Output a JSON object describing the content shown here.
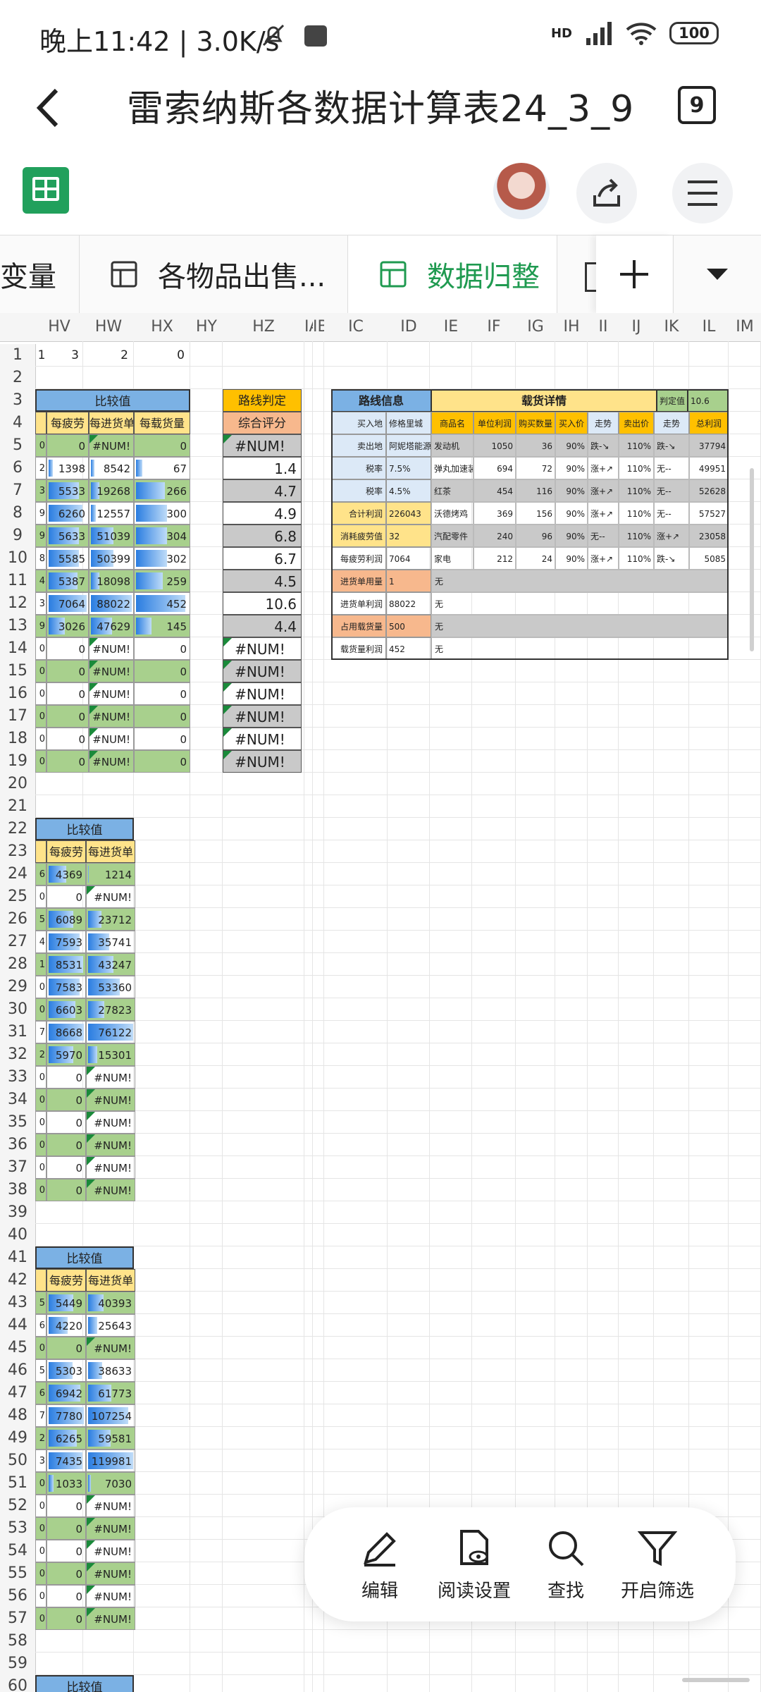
{
  "status": {
    "time": "晚上11:42 | 3.0K/s",
    "net": "HD",
    "battery": "100"
  },
  "header": {
    "title": "雷索纳斯各数据计算表24_3_9",
    "tab_count": "9"
  },
  "sheet_tabs": [
    {
      "label": "变量"
    },
    {
      "label": "各物品出售..."
    },
    {
      "label": "数据归整"
    }
  ],
  "columns": [
    "HV",
    "HW",
    "HX",
    "HY",
    "HZ",
    "IA",
    "IB",
    "IC",
    "ID",
    "IE",
    "IF",
    "IG",
    "IH",
    "II",
    "IJ",
    "IK",
    "IL",
    "IM"
  ],
  "rows": [
    "1",
    "2",
    "3",
    "4",
    "5",
    "6",
    "7",
    "8",
    "9",
    "10",
    "11",
    "12",
    "13",
    "14",
    "15",
    "16",
    "17",
    "18",
    "19",
    "20",
    "21",
    "22",
    "23",
    "24",
    "25",
    "26",
    "27",
    "28",
    "29",
    "30",
    "31",
    "32",
    "33",
    "34",
    "35",
    "36",
    "37",
    "38",
    "39",
    "40",
    "41",
    "42",
    "43",
    "44",
    "45",
    "46",
    "47",
    "48",
    "49",
    "50",
    "51",
    "52",
    "53",
    "54",
    "55",
    "56",
    "57",
    "58",
    "59",
    "60"
  ],
  "row1": {
    "hv": "3",
    "hw": "2",
    "hx": "0",
    "left": "1"
  },
  "block1": {
    "title": "比较值",
    "headers": [
      "每疲劳",
      "每进货单",
      "每载货量"
    ],
    "rows": [
      {
        "l": "0",
        "a": "0",
        "b": "#NUM!",
        "c": "0",
        "g": 1
      },
      {
        "l": "2",
        "a": "1398",
        "b": "8542",
        "c": "67",
        "g": 0,
        "pa": 0.12,
        "pb": 0.08,
        "pc": 0.12
      },
      {
        "l": "3",
        "a": "5533",
        "b": "19268",
        "c": "266",
        "g": 1,
        "pa": 0.8,
        "pb": 0.2,
        "pc": 0.55
      },
      {
        "l": "9",
        "a": "6260",
        "b": "12557",
        "c": "300",
        "g": 0,
        "pa": 0.88,
        "pb": 0.12,
        "pc": 0.6
      },
      {
        "l": "9",
        "a": "5633",
        "b": "51039",
        "c": "304",
        "g": 1,
        "pa": 0.8,
        "pb": 0.55,
        "pc": 0.6
      },
      {
        "l": "8",
        "a": "5585",
        "b": "50399",
        "c": "302",
        "g": 0,
        "pa": 0.79,
        "pb": 0.55,
        "pc": 0.6
      },
      {
        "l": "4",
        "a": "5387",
        "b": "18098",
        "c": "259",
        "g": 1,
        "pa": 0.76,
        "pb": 0.2,
        "pc": 0.52
      },
      {
        "l": "3",
        "a": "7064",
        "b": "88022",
        "c": "452",
        "g": 0,
        "pa": 1.0,
        "pb": 1.0,
        "pc": 0.95
      },
      {
        "l": "9",
        "a": "3026",
        "b": "47629",
        "c": "145",
        "g": 1,
        "pa": 0.43,
        "pb": 0.52,
        "pc": 0.3
      },
      {
        "l": "0",
        "a": "0",
        "b": "#NUM!",
        "c": "0",
        "g": 0
      },
      {
        "l": "0",
        "a": "0",
        "b": "#NUM!",
        "c": "0",
        "g": 1
      },
      {
        "l": "0",
        "a": "0",
        "b": "#NUM!",
        "c": "0",
        "g": 0
      },
      {
        "l": "0",
        "a": "0",
        "b": "#NUM!",
        "c": "0",
        "g": 1
      },
      {
        "l": "0",
        "a": "0",
        "b": "#NUM!",
        "c": "0",
        "g": 0
      },
      {
        "l": "0",
        "a": "0",
        "b": "#NUM!",
        "c": "0",
        "g": 1
      }
    ]
  },
  "route": {
    "title": "路线判定",
    "subtitle": "综合评分",
    "scores": [
      "#NUM!",
      "1.4",
      "4.7",
      "4.9",
      "6.8",
      "6.7",
      "4.5",
      "10.6",
      "4.4",
      "#NUM!",
      "#NUM!",
      "#NUM!",
      "#NUM!",
      "#NUM!",
      "#NUM!"
    ]
  },
  "info": {
    "title": "路线信息",
    "cargo_title": "载货详情",
    "judge_label": "判定值",
    "judge_value": "10.6",
    "headers": [
      "商品名",
      "单位利润",
      "购买数量",
      "买入价",
      "走势",
      "卖出价",
      "走势",
      "总利润"
    ],
    "left": [
      {
        "k": "买入地",
        "v": "修格里城"
      },
      {
        "k": "卖出地",
        "v": "阿妮塔能源"
      },
      {
        "k": "税率",
        "v": "7.5%"
      },
      {
        "k": "税率",
        "v": "4.5%"
      },
      {
        "k": "合计利润",
        "v": "226043"
      },
      {
        "k": "消耗疲劳值",
        "v": "32"
      },
      {
        "k": "每疲劳利润",
        "v": "7064"
      },
      {
        "k": "进货单用量",
        "v": "1"
      },
      {
        "k": "进货单利润",
        "v": "88022"
      },
      {
        "k": "占用载货量",
        "v": "500"
      },
      {
        "k": "载货量利润",
        "v": "452"
      }
    ],
    "goods": [
      [
        "发动机",
        "1050",
        "36",
        "90%",
        "跌-↘",
        "110%",
        "跌-↘",
        "37794"
      ],
      [
        "弹丸加速装置",
        "694",
        "72",
        "90%",
        "涨+↗",
        "110%",
        "无--",
        "49951"
      ],
      [
        "红茶",
        "454",
        "116",
        "90%",
        "涨+↗",
        "110%",
        "无--",
        "52628"
      ],
      [
        "沃德烤鸡",
        "369",
        "156",
        "90%",
        "涨+↗",
        "110%",
        "无--",
        "57527"
      ],
      [
        "汽配零件",
        "240",
        "96",
        "90%",
        "无--",
        "110%",
        "涨+↗",
        "23058"
      ],
      [
        "家电",
        "212",
        "24",
        "90%",
        "涨+↗",
        "110%",
        "跌-↘",
        "5085"
      ]
    ],
    "none": "无"
  },
  "block2": {
    "title": "比较值",
    "headers": [
      "每疲劳",
      "每进货单"
    ],
    "rows": [
      {
        "l": "6",
        "a": "4369",
        "b": "1214",
        "g": 1,
        "pa": 0.5,
        "pb": 0.01
      },
      {
        "l": "0",
        "a": "0",
        "b": "#NUM!",
        "g": 0
      },
      {
        "l": "5",
        "a": "6089",
        "b": "23712",
        "g": 1,
        "pa": 0.7,
        "pb": 0.3
      },
      {
        "l": "4",
        "a": "7593",
        "b": "35741",
        "g": 0,
        "pa": 0.87,
        "pb": 0.47
      },
      {
        "l": "1",
        "a": "8531",
        "b": "43247",
        "g": 1,
        "pa": 0.98,
        "pb": 0.57
      },
      {
        "l": "0",
        "a": "7583",
        "b": "53360",
        "g": 0,
        "pa": 0.87,
        "pb": 0.7
      },
      {
        "l": "0",
        "a": "6603",
        "b": "27823",
        "g": 1,
        "pa": 0.76,
        "pb": 0.36
      },
      {
        "l": "7",
        "a": "8668",
        "b": "76122",
        "g": 0,
        "pa": 1.0,
        "pb": 1.0
      },
      {
        "l": "2",
        "a": "5970",
        "b": "15301",
        "g": 1,
        "pa": 0.69,
        "pb": 0.2
      },
      {
        "l": "0",
        "a": "0",
        "b": "#NUM!",
        "g": 0
      },
      {
        "l": "0",
        "a": "0",
        "b": "#NUM!",
        "g": 1
      },
      {
        "l": "0",
        "a": "0",
        "b": "#NUM!",
        "g": 0
      },
      {
        "l": "0",
        "a": "0",
        "b": "#NUM!",
        "g": 1
      },
      {
        "l": "0",
        "a": "0",
        "b": "#NUM!",
        "g": 0
      },
      {
        "l": "0",
        "a": "0",
        "b": "#NUM!",
        "g": 1
      }
    ]
  },
  "block3": {
    "title": "比较值",
    "headers": [
      "每疲劳",
      "每进货单"
    ],
    "rows": [
      {
        "l": "5",
        "a": "5449",
        "b": "40393",
        "g": 1,
        "pa": 0.7,
        "pb": 0.34
      },
      {
        "l": "6",
        "a": "4220",
        "b": "25643",
        "g": 0,
        "pa": 0.54,
        "pb": 0.21
      },
      {
        "l": "0",
        "a": "0",
        "b": "#NUM!",
        "g": 1
      },
      {
        "l": "5",
        "a": "5303",
        "b": "38633",
        "g": 0,
        "pa": 0.68,
        "pb": 0.32
      },
      {
        "l": "6",
        "a": "6942",
        "b": "61773",
        "g": 1,
        "pa": 0.89,
        "pb": 0.51
      },
      {
        "l": "7",
        "a": "7780",
        "b": "107254",
        "g": 0,
        "pa": 1.0,
        "pb": 0.89
      },
      {
        "l": "2",
        "a": "6265",
        "b": "59581",
        "g": 1,
        "pa": 0.8,
        "pb": 0.5
      },
      {
        "l": "3",
        "a": "7435",
        "b": "119981",
        "g": 0,
        "pa": 0.95,
        "pb": 1.0
      },
      {
        "l": "0",
        "a": "1033",
        "b": "7030",
        "g": 1,
        "pa": 0.13,
        "pb": 0.06
      },
      {
        "l": "0",
        "a": "0",
        "b": "#NUM!",
        "g": 0
      },
      {
        "l": "0",
        "a": "0",
        "b": "#NUM!",
        "g": 1
      },
      {
        "l": "0",
        "a": "0",
        "b": "#NUM!",
        "g": 0
      },
      {
        "l": "0",
        "a": "0",
        "b": "#NUM!",
        "g": 1
      },
      {
        "l": "0",
        "a": "0",
        "b": "#NUM!",
        "g": 0
      },
      {
        "l": "0",
        "a": "0",
        "b": "#NUM!",
        "g": 1
      }
    ]
  },
  "block4": {
    "title": "比较值"
  },
  "fab": {
    "edit": "编辑",
    "read": "阅读设置",
    "find": "查找",
    "filter": "开启筛选"
  },
  "colors": {
    "accent_green": "#1f9a50",
    "header_blue": "#7bb1e4",
    "orange": "#ffc000",
    "green_fill": "#a8d08d"
  }
}
